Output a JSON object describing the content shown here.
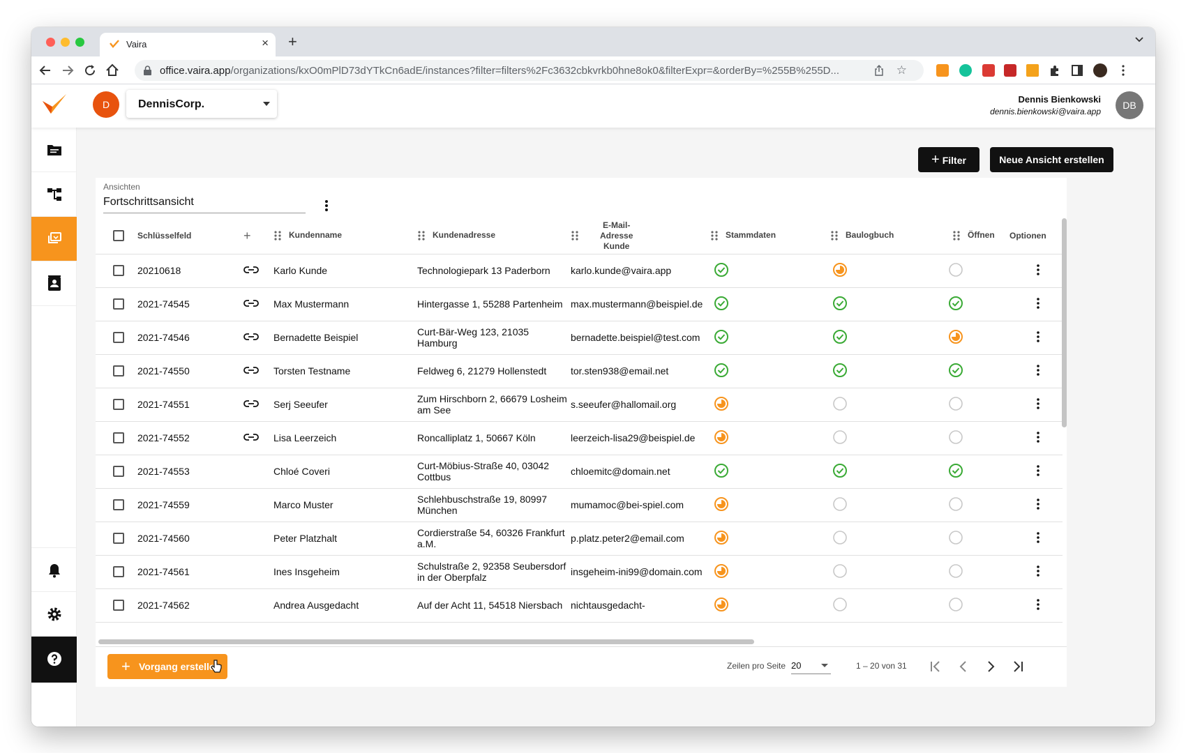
{
  "browser": {
    "tab_title": "Vaira",
    "url_host": "office.vaira.app",
    "url_path": "/organizations/kxO0mPlD73dYTkCn6adE/instances?filter=filters%2Fc3632cbkvrkb0hne8ok0&filterExpr=&orderBy=%255B%255D..."
  },
  "header": {
    "org_avatar": "D",
    "org_name": "DennisCorp.",
    "user_name": "Dennis Bienkowski",
    "user_email": "dennis.bienkowski@vaira.app",
    "user_initials": "DB"
  },
  "toolbar": {
    "filter_label": "Filter",
    "new_view_label": "Neue Ansicht erstellen"
  },
  "views": {
    "label": "Ansichten",
    "value": "Fortschrittsansicht"
  },
  "table": {
    "columns": {
      "key": "Schlüsselfeld",
      "add": "+",
      "name": "Kundenname",
      "address": "Kundenadresse",
      "email_line1": "E-Mail-",
      "email_line2": "Adresse",
      "email_line3": "Kunde",
      "master": "Stammdaten",
      "log": "Baulogbuch",
      "open": "Öffnen",
      "options": "Optionen"
    },
    "rows": [
      {
        "key": "20210618",
        "linked": true,
        "name": "Karlo Kunde",
        "address": "Technologiepark 13 Paderborn",
        "email": "karlo.kunde@vaira.app",
        "master": "done",
        "log": "progress",
        "open": "empty"
      },
      {
        "key": "2021-74545",
        "linked": true,
        "name": "Max Mustermann",
        "address": "Hintergasse 1, 55288 Partenheim",
        "email": "max.mustermann@beispiel.de",
        "master": "done",
        "log": "done",
        "open": "done"
      },
      {
        "key": "2021-74546",
        "linked": true,
        "name": "Bernadette Beispiel",
        "address": "Curt-Bär-Weg 123, 21035 Hamburg",
        "email": "bernadette.beispiel@test.com",
        "master": "done",
        "log": "done",
        "open": "progress"
      },
      {
        "key": "2021-74550",
        "linked": true,
        "name": "Torsten Testname",
        "address": "Feldweg 6, 21279 Hollenstedt",
        "email": "tor.sten938@email.net",
        "master": "done",
        "log": "done",
        "open": "done"
      },
      {
        "key": "2021-74551",
        "linked": true,
        "name": "Serj Seeufer",
        "address": "Zum Hirschborn 2, 66679 Losheim am See",
        "email": "s.seeufer@hallomail.org",
        "master": "progress",
        "log": "empty",
        "open": "empty"
      },
      {
        "key": "2021-74552",
        "linked": true,
        "name": "Lisa Leerzeich",
        "address": "Roncalliplatz 1, 50667 Köln",
        "email": "leerzeich-lisa29@beispiel.de",
        "master": "progress",
        "log": "empty",
        "open": "empty"
      },
      {
        "key": "2021-74553",
        "linked": false,
        "name": "Chloé Coveri",
        "address": "Curt-Möbius-Straße 40, 03042 Cottbus",
        "email": "chloemitc@domain.net",
        "master": "done",
        "log": "done",
        "open": "done"
      },
      {
        "key": "2021-74559",
        "linked": false,
        "name": "Marco Muster",
        "address": "Schlehbuschstraße 19, 80997 München",
        "email": "mumamoc@bei-spiel.com",
        "master": "progress",
        "log": "empty",
        "open": "empty"
      },
      {
        "key": "2021-74560",
        "linked": false,
        "name": "Peter Platzhalt",
        "address": "Cordierstraße 54, 60326 Frankfurt a.M.",
        "email": "p.platz.peter2@email.com",
        "master": "progress",
        "log": "empty",
        "open": "empty"
      },
      {
        "key": "2021-74561",
        "linked": false,
        "name": "Ines Insgeheim",
        "address": "Schulstraße 2, 92358 Seubersdorf in der Oberpfalz",
        "email": "insgeheim-ini99@domain.com",
        "master": "progress",
        "log": "empty",
        "open": "empty"
      },
      {
        "key": "2021-74562",
        "linked": false,
        "name": "Andrea Ausgedacht",
        "address": "Auf der Acht 11, 54518 Niersbach",
        "email": "nichtausgedacht-",
        "master": "progress",
        "log": "empty",
        "open": "empty"
      }
    ]
  },
  "footer": {
    "create_label": "Vorgang erstellen",
    "rows_per_page_label": "Zeilen pro Seite",
    "rows_per_page_value": "20",
    "range": "1 – 20 von 31"
  },
  "colors": {
    "accent": "#f7941d",
    "done": "#3aaa35",
    "progress": "#f7941d",
    "empty": "#c8c8c8"
  }
}
